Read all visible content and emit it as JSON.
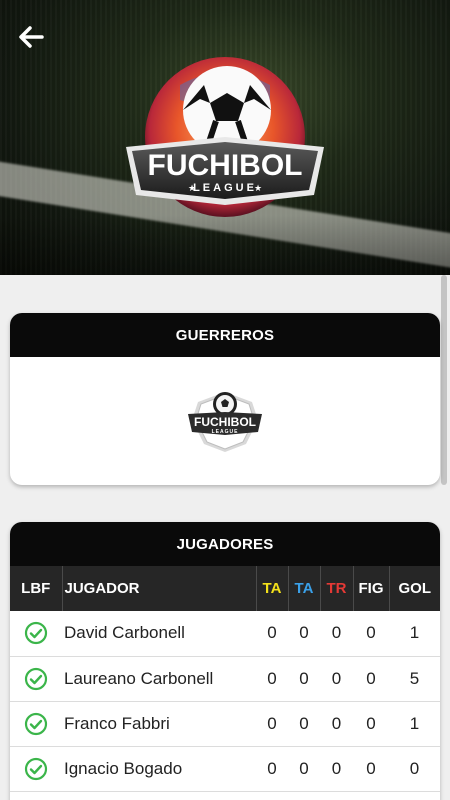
{
  "hero": {
    "logo_word": "FUCHIBOL",
    "logo_sub": "LEAGUE"
  },
  "team": {
    "name": "GUERREROS"
  },
  "players": {
    "title": "JUGADORES",
    "columns": [
      {
        "label": "LBF",
        "color": "#ffffff"
      },
      {
        "label": "JUGADOR",
        "color": "#ffffff"
      },
      {
        "label": "TA",
        "color": "#f2e01b"
      },
      {
        "label": "TA",
        "color": "#3aa0e8"
      },
      {
        "label": "TR",
        "color": "#e53935"
      },
      {
        "label": "FIG",
        "color": "#ffffff"
      },
      {
        "label": "GOL",
        "color": "#ffffff"
      }
    ],
    "rows": [
      {
        "name": "David Carbonell",
        "ta_yellow": "0",
        "ta_blue": "0",
        "tr": "0",
        "fig": "0",
        "gol": "1"
      },
      {
        "name": "Laureano Carbonell",
        "ta_yellow": "0",
        "ta_blue": "0",
        "tr": "0",
        "fig": "0",
        "gol": "5"
      },
      {
        "name": "Franco Fabbri",
        "ta_yellow": "0",
        "ta_blue": "0",
        "tr": "0",
        "fig": "0",
        "gol": "1"
      },
      {
        "name": "Ignacio Bogado",
        "ta_yellow": "0",
        "ta_blue": "0",
        "tr": "0",
        "fig": "0",
        "gol": "0"
      }
    ]
  },
  "colors": {
    "check_green": "#3bb54a",
    "header_black": "#0a0a0a"
  }
}
